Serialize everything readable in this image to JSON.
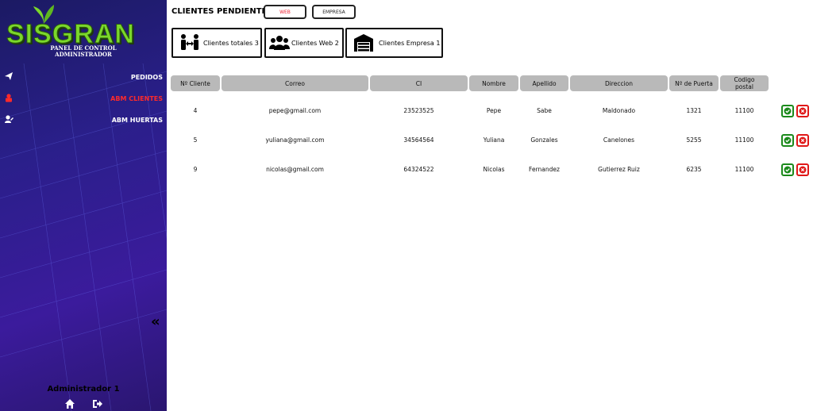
{
  "sidebar": {
    "logo_text": "SISGRAN",
    "subtitle_line1": "PANEL DE CONTROL",
    "subtitle_line2": "ADMINISTRADOR",
    "items": [
      {
        "label": "PEDIDOS",
        "icon": "paper-plane-icon"
      },
      {
        "label": "ABM CLIENTES",
        "icon": "user-lock-icon",
        "active": true
      },
      {
        "label": "ABM HUERTAS",
        "icon": "user-edit-icon"
      }
    ],
    "collapse_icon": "double-chevron-left-icon",
    "admin_name": "Administrador 1",
    "bottom_icons": [
      "home-icon",
      "logout-icon"
    ],
    "active_color": "#ff2a2a"
  },
  "header": {
    "title": "CLIENTES PENDIENTES :",
    "filter_web": "WEB",
    "filter_empresa": "EMPRESA"
  },
  "summary_cards": [
    {
      "label": "Clientes totales 3",
      "icon": "people-arrows-icon"
    },
    {
      "label": "Clientes Web 2",
      "icon": "users-icon"
    },
    {
      "label": "Clientes Empresa 1",
      "icon": "warehouse-icon"
    }
  ],
  "table": {
    "columns": [
      "Nº Cliente",
      "Correo",
      "CI",
      "Nombre",
      "Apellido",
      "Direccion",
      "Nº de Puerta",
      "Codigo postal"
    ],
    "rows": [
      [
        "4",
        "pepe@gmail.com",
        "23523525",
        "Pepe",
        "Sabe",
        "Maldonado",
        "1321",
        "11100"
      ],
      [
        "5",
        "yuliana@gmail.com",
        "34564564",
        "Yuliana",
        "Gonzales",
        "Canelones",
        "5255",
        "11100"
      ],
      [
        "9",
        "nicolas@gmail.com",
        "64324522",
        "Nicolas",
        "Fernandez",
        "Gutierrez Ruiz",
        "6235",
        "11100"
      ]
    ],
    "actions": {
      "approve_icon": "check-circle-icon",
      "reject_icon": "x-circle-icon",
      "approve_color": "#1b8a1b",
      "reject_color": "#e01818"
    }
  }
}
